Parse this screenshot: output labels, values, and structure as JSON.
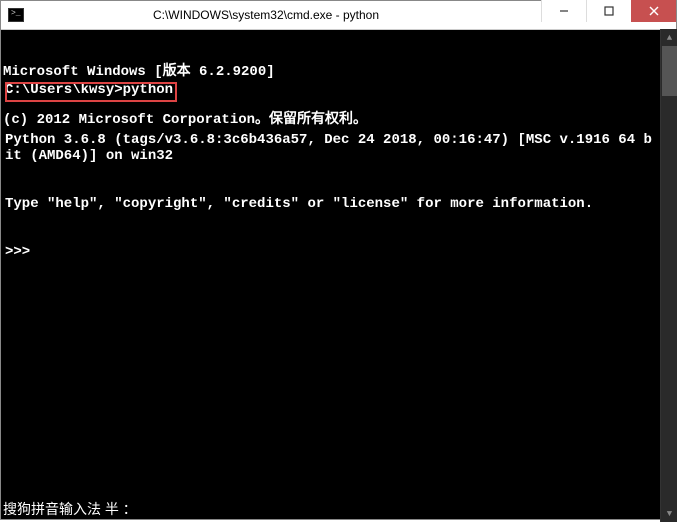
{
  "titlebar": {
    "title": "C:\\WINDOWS\\system32\\cmd.exe - python"
  },
  "console": {
    "line1": "Microsoft Windows [版本 6.2.9200]",
    "line2": "(c) 2012 Microsoft Corporation。保留所有权利。",
    "blank": "",
    "prompt_line": "C:\\Users\\kwsy>python",
    "py_version": "Python 3.6.8 (tags/v3.6.8:3c6b436a57, Dec 24 2018, 00:16:47) [MSC v.1916 64 bit (AMD64)] on win32",
    "py_help": "Type \"help\", \"copyright\", \"credits\" or \"license\" for more information.",
    "py_prompt": ">>>"
  },
  "ime": {
    "text": "搜狗拼音输入法 半 ："
  }
}
